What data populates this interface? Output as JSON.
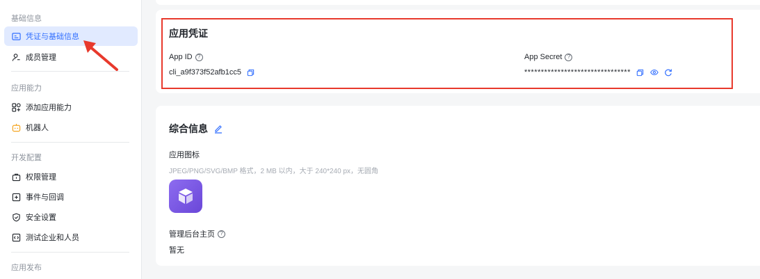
{
  "sidebar": {
    "sections": [
      {
        "title": "基础信息",
        "items": [
          {
            "label": "凭证与基础信息",
            "icon": "id-card-icon",
            "active": true
          },
          {
            "label": "成员管理",
            "icon": "member-icon"
          }
        ]
      },
      {
        "title": "应用能力",
        "items": [
          {
            "label": "添加应用能力",
            "icon": "grid-add-icon"
          },
          {
            "label": "机器人",
            "icon": "robot-icon"
          }
        ]
      },
      {
        "title": "开发配置",
        "items": [
          {
            "label": "权限管理",
            "icon": "permission-icon"
          },
          {
            "label": "事件与回调",
            "icon": "event-icon"
          },
          {
            "label": "安全设置",
            "icon": "shield-icon"
          },
          {
            "label": "测试企业和人员",
            "icon": "code-icon"
          }
        ]
      },
      {
        "title": "应用发布",
        "items": []
      }
    ]
  },
  "credentials": {
    "title": "应用凭证",
    "app_id_label": "App ID",
    "app_id_value": "cli_a9f373f52afb1cc5",
    "app_secret_label": "App Secret",
    "app_secret_value": "********************************"
  },
  "info": {
    "title": "综合信息",
    "icon_label": "应用图标",
    "icon_hint": "JPEG/PNG/SVG/BMP 格式，2 MB 以内，大于 240*240 px，无圆角",
    "homepage_label": "管理后台主页",
    "homepage_value": "暂无"
  },
  "colors": {
    "accent": "#3370ff",
    "active_bg": "#e1eaff",
    "annotation_red": "#e8392c",
    "app_icon": "#7b5ae6"
  }
}
